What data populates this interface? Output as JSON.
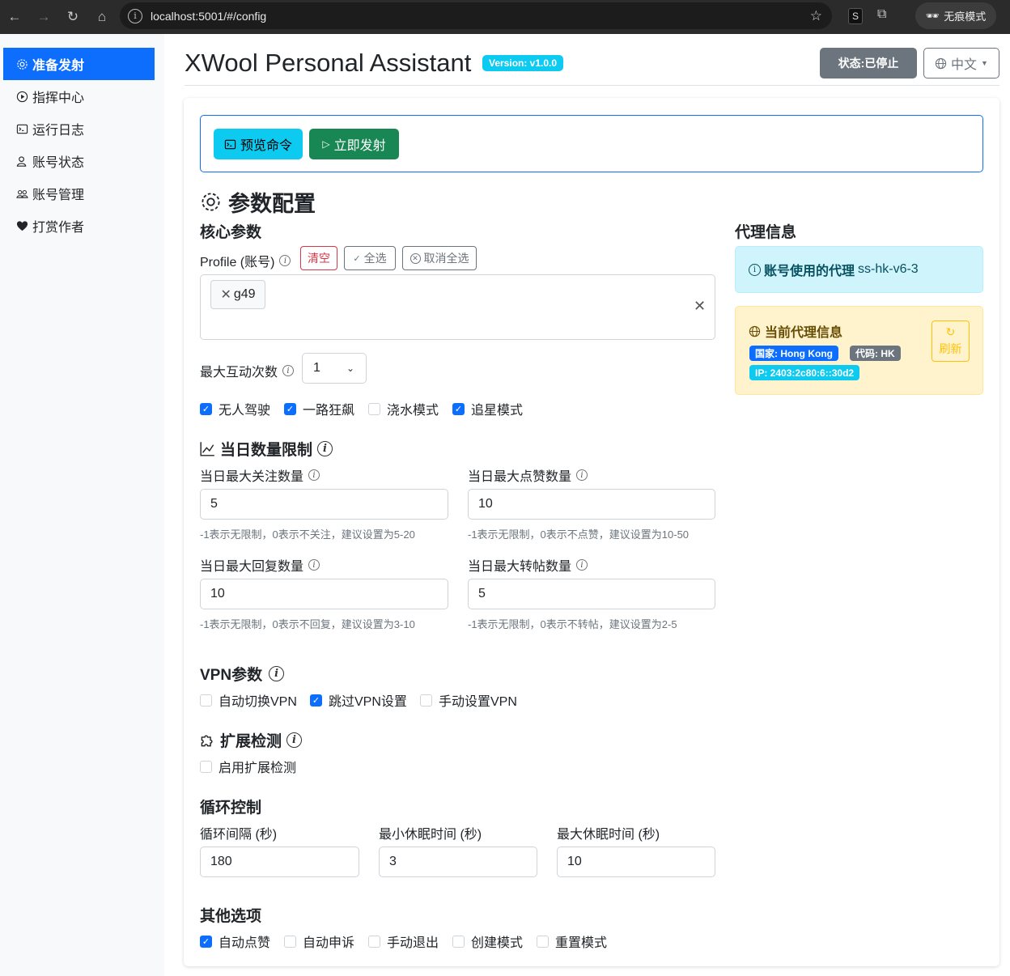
{
  "browser": {
    "url": "localhost:5001/#/config",
    "ext_label": "S",
    "incognito_label": "无痕模式"
  },
  "sidebar": {
    "items": [
      {
        "label": "准备发射",
        "icon": "gear-icon",
        "active": true
      },
      {
        "label": "指挥中心",
        "icon": "play-circle-icon"
      },
      {
        "label": "运行日志",
        "icon": "terminal-icon"
      },
      {
        "label": "账号状态",
        "icon": "person-icon"
      },
      {
        "label": "账号管理",
        "icon": "people-icon"
      },
      {
        "label": "打赏作者",
        "icon": "heart-icon"
      }
    ]
  },
  "header": {
    "title": "XWool Personal Assistant",
    "version": "Version: v1.0.0",
    "status": "状态:已停止",
    "language": "中文"
  },
  "actions": {
    "preview": "预览命令",
    "launch": "立即发射"
  },
  "config": {
    "title": "参数配置",
    "core": {
      "title": "核心参数",
      "profile_label": "Profile (账号)",
      "clear": "清空",
      "select_all": "全选",
      "deselect_all": "取消全选",
      "selected_profiles": [
        "g49"
      ],
      "max_interact_label": "最大互动次数",
      "max_interact_value": "1",
      "modes": [
        {
          "label": "无人驾驶",
          "checked": true
        },
        {
          "label": "一路狂飙",
          "checked": true
        },
        {
          "label": "浇水模式",
          "checked": false
        },
        {
          "label": "追星模式",
          "checked": true
        }
      ]
    },
    "daily": {
      "title": "当日数量限制",
      "follow": {
        "label": "当日最大关注数量",
        "value": "5",
        "help": "-1表示无限制，0表示不关注，建议设置为5-20"
      },
      "like": {
        "label": "当日最大点赞数量",
        "value": "10",
        "help": "-1表示无限制，0表示不点赞，建议设置为10-50"
      },
      "reply": {
        "label": "当日最大回复数量",
        "value": "10",
        "help": "-1表示无限制，0表示不回复，建议设置为3-10"
      },
      "repost": {
        "label": "当日最大转帖数量",
        "value": "5",
        "help": "-1表示无限制，0表示不转帖，建议设置为2-5"
      }
    },
    "vpn": {
      "title": "VPN参数",
      "options": [
        {
          "label": "自动切换VPN",
          "checked": false
        },
        {
          "label": "跳过VPN设置",
          "checked": true
        },
        {
          "label": "手动设置VPN",
          "checked": false
        }
      ]
    },
    "extension": {
      "title": "扩展检测",
      "option": {
        "label": "启用扩展检测",
        "checked": false
      }
    },
    "loop": {
      "title": "循环控制",
      "interval": {
        "label": "循环间隔 (秒)",
        "value": "180"
      },
      "min_sleep": {
        "label": "最小休眠时间 (秒)",
        "value": "3"
      },
      "max_sleep": {
        "label": "最大休眠时间 (秒)",
        "value": "10"
      }
    },
    "other": {
      "title": "其他选项",
      "options": [
        {
          "label": "自动点赞",
          "checked": true
        },
        {
          "label": "自动申诉",
          "checked": false
        },
        {
          "label": "手动退出",
          "checked": false
        },
        {
          "label": "创建模式",
          "checked": false
        },
        {
          "label": "重置模式",
          "checked": false
        }
      ]
    }
  },
  "proxy": {
    "title": "代理信息",
    "account_proxy_label": "账号使用的代理",
    "account_proxy_value": "ss-hk-v6-3",
    "current_title": "当前代理信息",
    "country": "国家: Hong Kong",
    "code": "代码: HK",
    "ip": "IP: 2403:2c80:6::30d2",
    "refresh": "刷新"
  },
  "colors": {
    "primary": "#0d6efd",
    "success": "#198754",
    "info": "#0dcaf0",
    "secondary": "#6c757d",
    "danger": "#dc3545",
    "warning": "#ffc107"
  }
}
